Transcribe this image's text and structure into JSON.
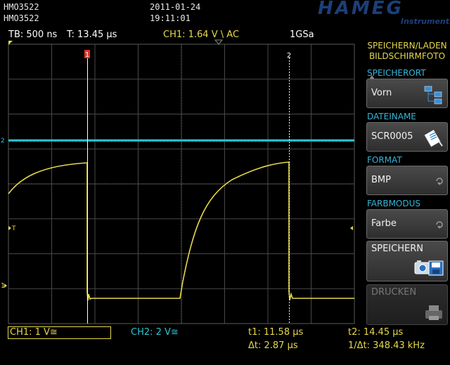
{
  "header": {
    "device_1": "HMO3522",
    "device_2": "HMO3522",
    "date": "2011-01-24",
    "time": "19:11:01",
    "brand": "HAMEG",
    "brand_sub": "Instruments"
  },
  "status": {
    "timebase": "TB: 500 ns",
    "trigger_time": "T: 13.45 µs",
    "trigger_channel": "CH1: 1.64 V",
    "trigger_slope": "\\",
    "coupling": "AC",
    "sample_rate": "1GSa"
  },
  "markers": {
    "cursor1": "1",
    "cursor2": "2",
    "ch2_level": "2",
    "ch1_level": "1",
    "trigger_level": "T"
  },
  "menu": {
    "title_line1": "SPEICHERN/LADEN",
    "title_line2": "BILDSCHIRMFOTO",
    "items": [
      {
        "label": "SPEICHERORT",
        "value": "Vorn"
      },
      {
        "label": "DATEINAME",
        "value": "SCR0005"
      },
      {
        "label": "FORMAT",
        "value": "BMP"
      },
      {
        "label": "FARBMODUS",
        "value": "Farbe"
      },
      {
        "label": "",
        "value": "SPEICHERN"
      },
      {
        "label": "",
        "value": "DRUCKEN"
      }
    ]
  },
  "bottom": {
    "ch1": "CH1: 1 V≅",
    "ch2": "CH2: 2 V≅",
    "t1": "t1: 11.58 µs",
    "t2": "t2: 14.45 µs",
    "dt": "Δt: 2.87 µs",
    "inv_dt": "1/Δt: 348.43 kHz"
  },
  "colors": {
    "ch1": "#e6d84a",
    "ch2": "#2fc4d2",
    "menu_label": "#35b6d8",
    "grid": "#4a4a4a"
  }
}
